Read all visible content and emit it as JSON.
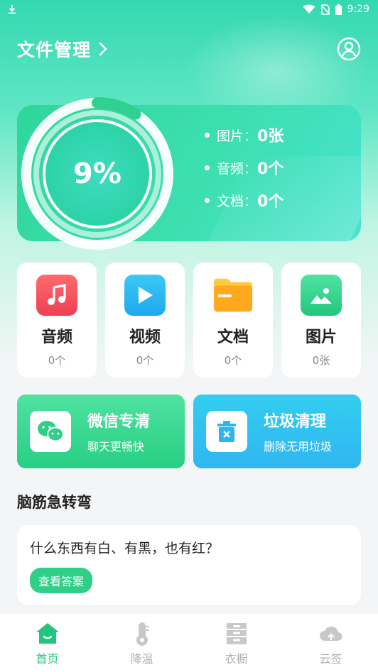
{
  "statusbar": {
    "time": "9:29"
  },
  "header": {
    "title": "文件管理",
    "chevron": "›"
  },
  "storage": {
    "percent": "9%",
    "used_fraction": 0.09,
    "stats": [
      {
        "label": "图片：",
        "value": "0张"
      },
      {
        "label": "音频：",
        "value": "0个"
      },
      {
        "label": "文档：",
        "value": "0个"
      }
    ]
  },
  "categories": [
    {
      "name": "音频",
      "count": "0个",
      "icon": "music-icon",
      "color": "#f0505c"
    },
    {
      "name": "视频",
      "count": "0个",
      "icon": "play-icon",
      "color": "#25b7f0"
    },
    {
      "name": "文档",
      "count": "0个",
      "icon": "folder-icon",
      "color": "#ffb023"
    },
    {
      "name": "图片",
      "count": "0张",
      "icon": "image-icon",
      "color": "#2fcf88"
    }
  ],
  "tools": [
    {
      "title": "微信专清",
      "subtitle": "聊天更畅快",
      "icon": "wechat-icon"
    },
    {
      "title": "垃圾清理",
      "subtitle": "删除无用垃圾",
      "icon": "trash-icon"
    }
  ],
  "riddle": {
    "section_title": "脑筋急转弯",
    "question": "什么东西有白、有黑，也有红？",
    "button_label": "查看答案"
  },
  "tabs": [
    {
      "label": "首页",
      "icon": "home-icon",
      "active": true
    },
    {
      "label": "降温",
      "icon": "thermometer-icon",
      "active": false
    },
    {
      "label": "衣橱",
      "icon": "wardrobe-icon",
      "active": false
    },
    {
      "label": "云签",
      "icon": "cloud-icon",
      "active": false
    }
  ],
  "colors": {
    "accent": "#22c57e",
    "card_green": "#2fd69a",
    "tab_inactive": "#b0b0b0"
  }
}
